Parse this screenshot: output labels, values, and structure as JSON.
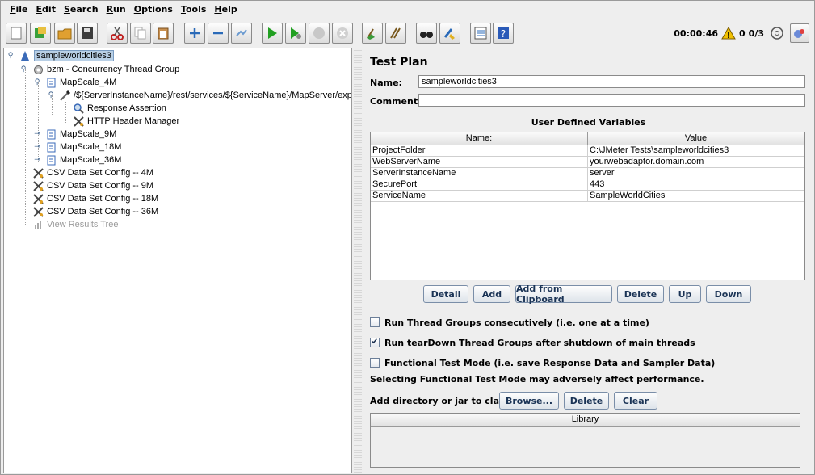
{
  "menu": [
    "File",
    "Edit",
    "Search",
    "Run",
    "Options",
    "Tools",
    "Help"
  ],
  "toolbar": {
    "timer": "00:00:46",
    "warnings": "0",
    "threads": "0/3"
  },
  "tree": {
    "root": "sampleworldcities3",
    "thread_group": "bzm - Concurrency Thread Group",
    "mapscale_4m": "MapScale_4M",
    "sampler": "/${ServerInstanceName}/rest/services/${ServiceName}/MapServer/export",
    "assertion": "Response Assertion",
    "header_manager": "HTTP Header Manager",
    "mapscale_9m": "MapScale_9M",
    "mapscale_18m": "MapScale_18M",
    "mapscale_36m": "MapScale_36M",
    "csv_4m": "CSV Data Set Config -- 4M",
    "csv_9m": "CSV Data Set Config -- 9M",
    "csv_18m": "CSV Data Set Config -- 18M",
    "csv_36m": "CSV Data Set Config -- 36M",
    "results_tree": "View Results Tree"
  },
  "test_plan": {
    "title": "Test Plan",
    "name_label": "Name:",
    "name_value": "sampleworldcities3",
    "comments_label": "Comments:",
    "comments_value": "",
    "udv_title": "User Defined Variables",
    "col_name": "Name:",
    "col_value": "Value",
    "variables": [
      {
        "name": "ProjectFolder",
        "value": "C:\\JMeter Tests\\sampleworldcities3"
      },
      {
        "name": "WebServerName",
        "value": "yourwebadaptor.domain.com"
      },
      {
        "name": "ServerInstanceName",
        "value": "server"
      },
      {
        "name": "SecurePort",
        "value": "443"
      },
      {
        "name": "ServiceName",
        "value": "SampleWorldCities"
      }
    ],
    "buttons": {
      "detail": "Detail",
      "add": "Add",
      "add_clipboard": "Add from Clipboard",
      "delete": "Delete",
      "up": "Up",
      "down": "Down"
    },
    "check_consecutive": "Run Thread Groups consecutively (i.e. one at a time)",
    "check_teardown": "Run tearDown Thread Groups after shutdown of main threads",
    "check_functional": "Functional Test Mode (i.e. save Response Data and Sampler Data)",
    "functional_note": "Selecting Functional Test Mode may adversely affect performance.",
    "classpath_label": "Add directory or jar to classpath",
    "browse": "Browse...",
    "cp_delete": "Delete",
    "clear": "Clear",
    "library_header": "Library"
  }
}
